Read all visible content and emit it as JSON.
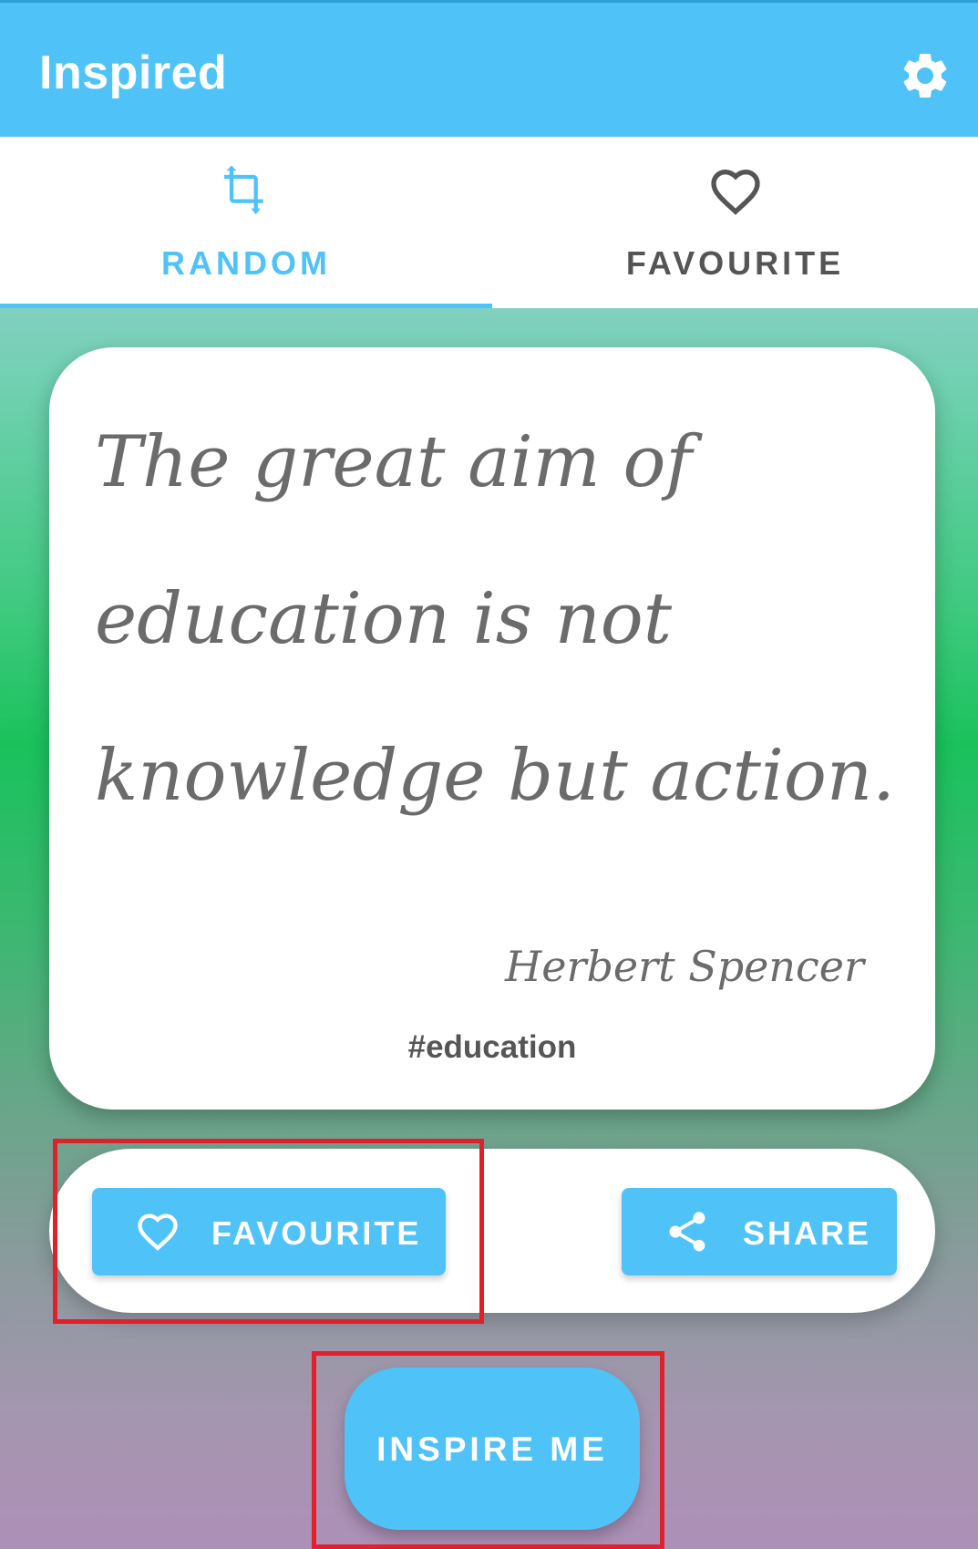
{
  "app": {
    "title": "Inspired",
    "settings_icon": "gear-icon"
  },
  "tabs": [
    {
      "label": "RANDOM",
      "icon": "crop-rotate-icon",
      "selected": true
    },
    {
      "label": "FAVOURITE",
      "icon": "heart-outline-icon",
      "selected": false
    }
  ],
  "quote": {
    "text": "The great aim of education is not knowledge but action.",
    "author": "Herbert Spencer",
    "tag": "#education"
  },
  "actions": {
    "favourite": {
      "label": "FAVOURITE",
      "icon": "heart-outline-icon"
    },
    "share": {
      "label": "SHARE",
      "icon": "share-icon"
    }
  },
  "inspire_button": {
    "label": "INSPIRE ME"
  },
  "colors": {
    "accent": "#4fc3f7",
    "text_muted": "#6b6b6b",
    "highlight": "#e0202a"
  }
}
